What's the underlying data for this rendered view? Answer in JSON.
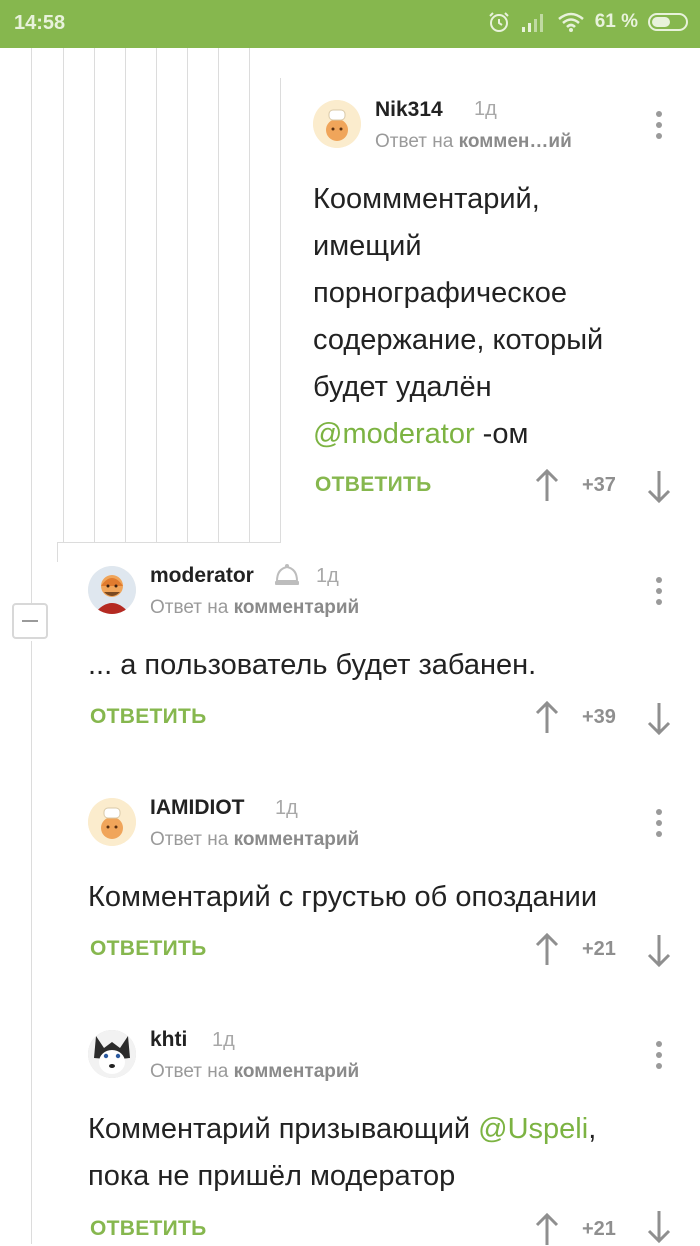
{
  "status": {
    "time": "14:58",
    "battery": "61 %",
    "battery_level": 0.61
  },
  "comments": [
    {
      "user": "Nik314",
      "time": "1д",
      "reply_prefix": "Ответ на",
      "reply_target": "коммен…ий",
      "text_lines": [
        "Кооммментарий,",
        "имещий",
        "порнографическое",
        "содержание, который",
        "будет удалён"
      ],
      "mention": "@moderator",
      "text_suffix": " -ом",
      "reply_label": "ОТВЕТИТЬ",
      "score": "+37",
      "avatar": "cook-avatar"
    },
    {
      "user": "moderator",
      "time": "1д",
      "reply_prefix": "Ответ на",
      "reply_target": "комментарий",
      "text": "... а пользователь будет забанен.",
      "reply_label": "ОТВЕТИТЬ",
      "score": "+39",
      "avatar": "warrior-avatar"
    },
    {
      "user": "IAMIDIOT",
      "time": "1д",
      "reply_prefix": "Ответ на",
      "reply_target": "комментарий",
      "text": "Комментарий с грустью об опоздании",
      "reply_label": "ОТВЕТИТЬ",
      "score": "+21",
      "avatar": "cook-avatar"
    },
    {
      "user": "khti",
      "time": "1д",
      "reply_prefix": "Ответ на",
      "reply_target": "комментарий",
      "text_prefix": "Комментарий призывающий ",
      "mention": "@Uspeli",
      "text_suffix": ",",
      "text_line2": "пока не пришёл модератор",
      "reply_label": "ОТВЕТИТЬ",
      "score": "+21",
      "avatar": "husky-avatar"
    }
  ],
  "colors": {
    "accent": "#86b74e",
    "mention": "#7cb342",
    "statusbar": "#86b74e"
  }
}
